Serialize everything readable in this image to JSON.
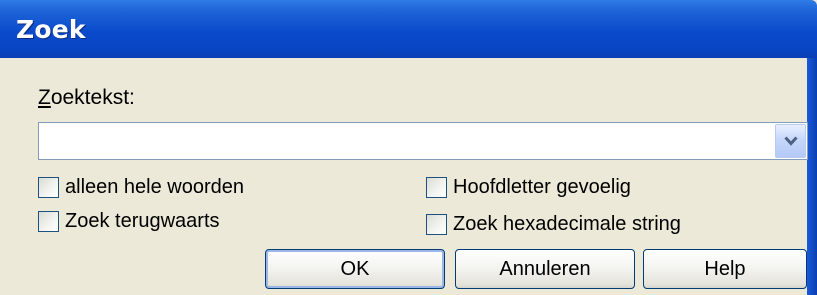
{
  "dialog": {
    "title": "Zoek"
  },
  "search": {
    "label_accel": "Z",
    "label_rest": "oektekst:",
    "value": ""
  },
  "options": {
    "whole_words": "alleen hele woorden",
    "case_sensitive": "Hoofdletter gevoelig",
    "search_backwards": "Zoek terugwaarts",
    "hex_string": "Zoek hexadecimale string"
  },
  "buttons": {
    "ok": "OK",
    "cancel": "Annuleren",
    "help": "Help"
  },
  "icons": {
    "dropdown": "chevron-down-icon"
  }
}
